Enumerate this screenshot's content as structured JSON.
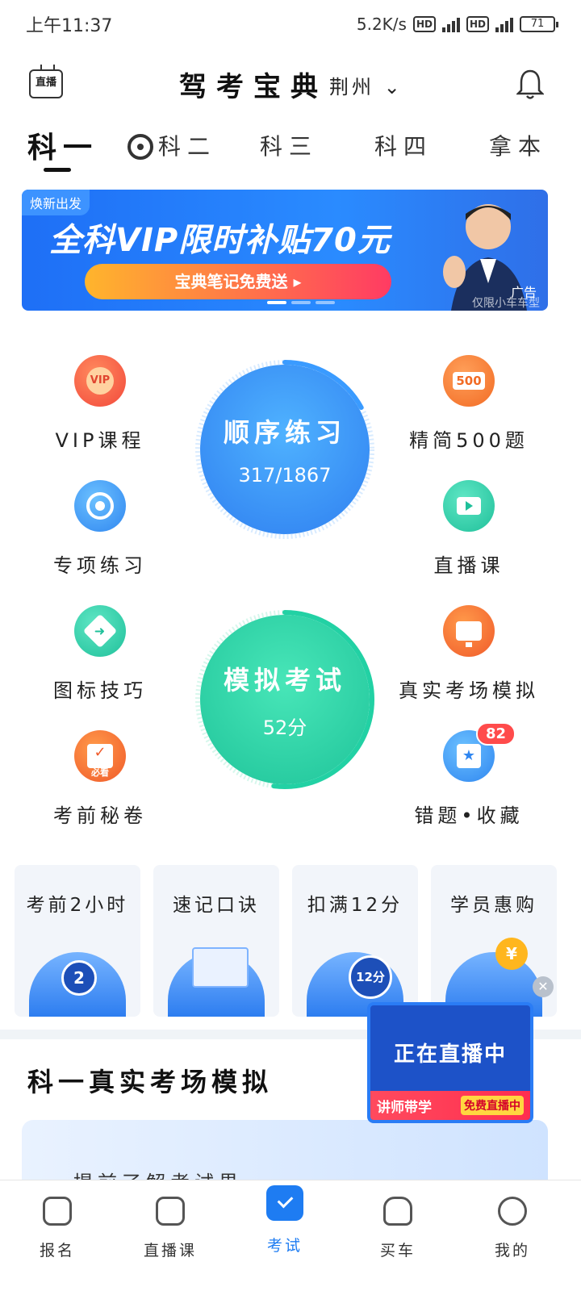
{
  "status_bar": {
    "time": "上午11:37",
    "speed": "5.2K/s",
    "network_a": "4G",
    "network_b": "5G",
    "battery": "71"
  },
  "header": {
    "live_label": "直播",
    "title": "驾考宝典",
    "city": "荆州"
  },
  "subject_tabs": [
    {
      "label": "科一",
      "active": true
    },
    {
      "label": "科二",
      "active": false
    },
    {
      "label": "科三",
      "active": false
    },
    {
      "label": "科四",
      "active": false
    },
    {
      "label": "拿本",
      "active": false
    }
  ],
  "banner": {
    "tag": "焕新出发",
    "title": "全科VIP限时补贴70元",
    "pill": "宝典笔记免费送 ▸",
    "ad_label": "广告",
    "note": "仅限小车车型"
  },
  "practice": {
    "vip_course": "VIP课程",
    "special": "专项练习",
    "sign_tips": "图标技巧",
    "secret": "考前秘卷",
    "secret_badge": "必看",
    "vip_icon_text": "VIP",
    "select500": "精简500题",
    "select500_icon_text": "500",
    "live_class": "直播课",
    "real_exam": "真实考场模拟",
    "mistakes": "错题•收藏",
    "mistakes_badge": "82"
  },
  "sequence": {
    "title": "顺序练习",
    "progress": "317/1867",
    "progress_fraction": 0.17
  },
  "mock": {
    "title": "模拟考试",
    "score": "52分",
    "progress_fraction": 0.52
  },
  "feature_cards": [
    {
      "title": "考前2小时",
      "art_text": "2"
    },
    {
      "title": "速记口诀",
      "art_text": ""
    },
    {
      "title": "扣满12分",
      "art_text": "12分"
    },
    {
      "title": "学员惠购",
      "art_text": "¥"
    }
  ],
  "section": {
    "title": "科一真实考场模拟",
    "card_text": "提前了解考试界"
  },
  "live_popup": {
    "title": "正在直播中",
    "teacher": "讲师带学",
    "free": "免费直播中",
    "close": "✕"
  },
  "bottom_nav": [
    {
      "label": "报名",
      "icon": "signup-icon",
      "active": false
    },
    {
      "label": "直播课",
      "icon": "tv-icon",
      "active": false
    },
    {
      "label": "考试",
      "icon": "exam-icon",
      "active": true
    },
    {
      "label": "买车",
      "icon": "car-icon",
      "active": false
    },
    {
      "label": "我的",
      "icon": "profile-icon",
      "active": false
    }
  ],
  "colors": {
    "accent": "#1e7cf2",
    "sequence_gradient": [
      "#4aa6ff",
      "#3a7df0"
    ],
    "mock_gradient": [
      "#3fdfb0",
      "#1fc49a"
    ]
  }
}
